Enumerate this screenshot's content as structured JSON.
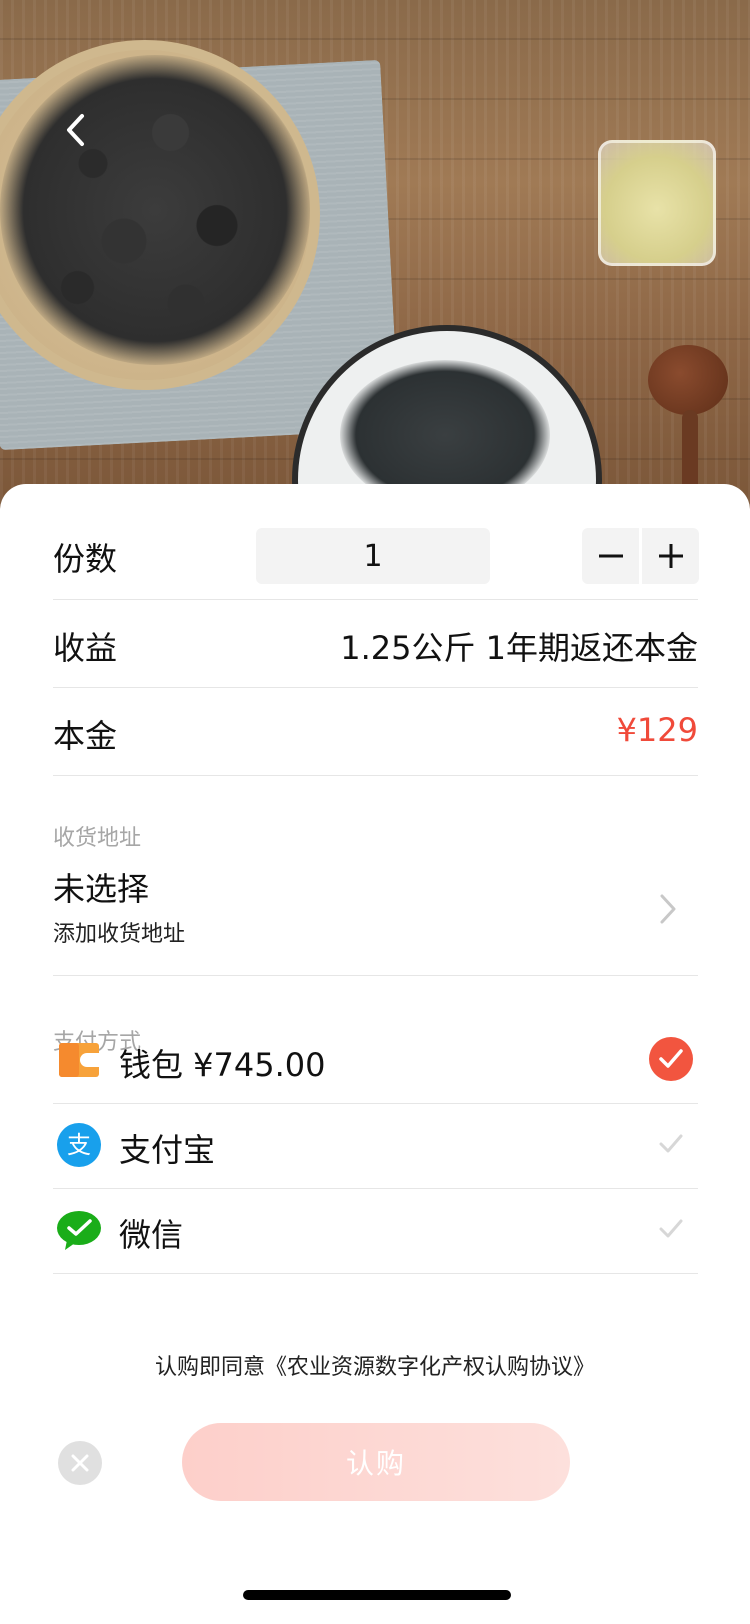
{
  "quantity": {
    "label": "份数",
    "value": "1"
  },
  "income": {
    "label": "收益",
    "value": "1.25公斤 1年期返还本金"
  },
  "principal": {
    "label": "本金",
    "value": "¥129"
  },
  "address": {
    "section_title": "收货地址",
    "status": "未选择",
    "action": "添加收货地址"
  },
  "payment": {
    "section_title": "支付方式",
    "methods": [
      {
        "label": "钱包 ¥745.00",
        "icon": "wallet-icon",
        "selected": true
      },
      {
        "label": "支付宝",
        "icon": "alipay-icon",
        "selected": false
      },
      {
        "label": "微信",
        "icon": "wechat-icon",
        "selected": false
      }
    ]
  },
  "agreement": "认购即同意《农业资源数字化产权认购协议》",
  "buy_button": "认购",
  "colors": {
    "accent": "#f04a3a",
    "selected_check": "#f2553f",
    "button_gradient_start": "#fdcfca",
    "button_gradient_end": "#fde0dc"
  }
}
